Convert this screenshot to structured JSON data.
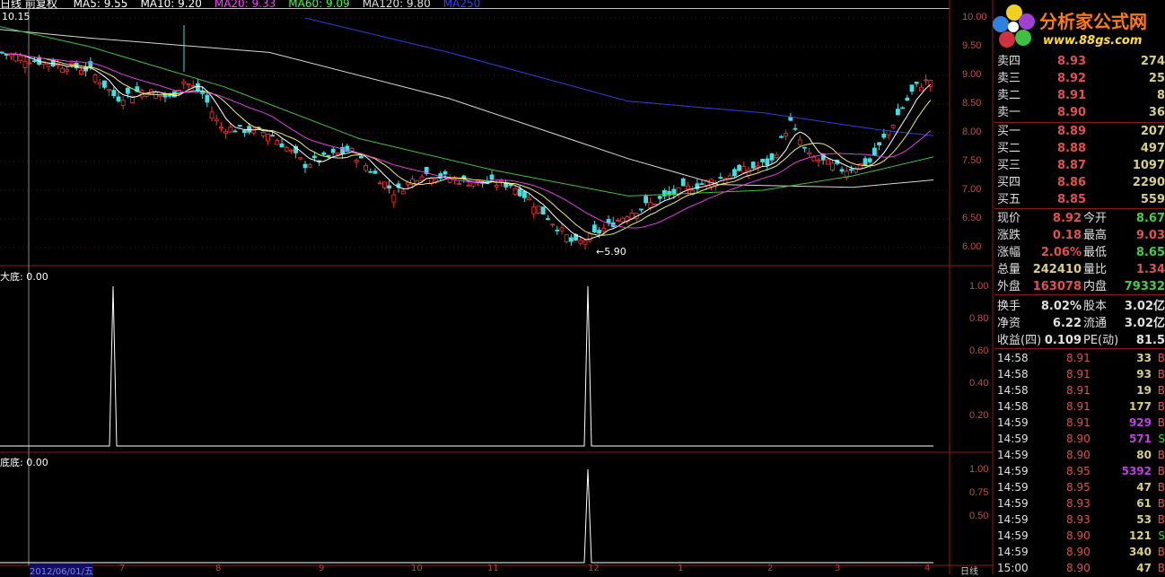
{
  "header": {
    "title": "日线 前复权",
    "ma": [
      {
        "label": "MA5: 9.55",
        "color": "#ffffff"
      },
      {
        "label": "MA10: 9.20",
        "color": "#ffffff"
      },
      {
        "label": "MA20: 9.33",
        "color": "#ff40ff"
      },
      {
        "label": "MA60: 9.09",
        "color": "#40ff40"
      },
      {
        "label": "MA120: 9.80",
        "color": "#e0e0e0"
      },
      {
        "label": "MA250",
        "color": "#3040ff"
      }
    ]
  },
  "main_chart": {
    "max_label": "10.15",
    "min_label": "5.90",
    "price_axis": [
      "10.00",
      "9.50",
      "9.00",
      "8.50",
      "8.00",
      "7.50",
      "7.00",
      "6.50",
      "6.00"
    ],
    "price_path": [
      [
        0,
        9.4
      ],
      [
        40,
        9.25
      ],
      [
        100,
        9.1
      ],
      [
        130,
        8.6
      ],
      [
        160,
        8.75
      ],
      [
        190,
        8.6
      ],
      [
        205,
        8.9
      ],
      [
        225,
        8.7
      ],
      [
        245,
        8.1
      ],
      [
        300,
        8.0
      ],
      [
        340,
        7.45
      ],
      [
        390,
        7.7
      ],
      [
        440,
        6.95
      ],
      [
        470,
        7.3
      ],
      [
        520,
        7.15
      ],
      [
        570,
        7.1
      ],
      [
        600,
        6.7
      ],
      [
        640,
        6.05
      ],
      [
        660,
        6.2
      ],
      [
        700,
        6.6
      ],
      [
        760,
        7.0
      ],
      [
        820,
        7.3
      ],
      [
        860,
        7.5
      ],
      [
        880,
        8.2
      ],
      [
        900,
        7.6
      ],
      [
        940,
        7.35
      ],
      [
        970,
        7.5
      ],
      [
        1000,
        8.3
      ],
      [
        1020,
        8.8
      ],
      [
        1040,
        8.95
      ]
    ],
    "ma_lines": {
      "ma120": {
        "color": "#d8d8d8",
        "pts": [
          [
            0,
            9.8
          ],
          [
            100,
            9.65
          ],
          [
            300,
            9.4
          ],
          [
            500,
            8.6
          ],
          [
            700,
            7.55
          ],
          [
            800,
            7.1
          ],
          [
            950,
            7.05
          ],
          [
            1040,
            7.18
          ]
        ]
      },
      "ma250": {
        "color": "#3040e0",
        "pts": [
          [
            340,
            10.0
          ],
          [
            500,
            9.4
          ],
          [
            700,
            8.55
          ],
          [
            850,
            8.35
          ],
          [
            980,
            8.05
          ],
          [
            1040,
            7.95
          ]
        ]
      },
      "ma60": {
        "color": "#40c040",
        "pts": [
          [
            0,
            9.85
          ],
          [
            100,
            9.5
          ],
          [
            250,
            8.8
          ],
          [
            400,
            7.9
          ],
          [
            550,
            7.35
          ],
          [
            700,
            6.9
          ],
          [
            850,
            7.0
          ],
          [
            950,
            7.25
          ],
          [
            1040,
            7.58
          ]
        ]
      }
    }
  },
  "indicator1": {
    "label": "大底: 0.00",
    "axis": [
      "1.00",
      "0.80",
      "0.60",
      "0.40",
      "0.20"
    ],
    "spikes": [
      126,
      655
    ]
  },
  "indicator2": {
    "label": "底底: 0.00",
    "axis": [
      "1.00",
      "0.75",
      "0.50"
    ],
    "spikes": [
      655
    ]
  },
  "x_axis": {
    "start": "2012/06/01/五",
    "months": [
      [
        "7",
        133
      ],
      [
        "8",
        240
      ],
      [
        "9",
        355
      ],
      [
        "10",
        458
      ],
      [
        "11",
        543
      ],
      [
        "12",
        655
      ],
      [
        "1",
        755
      ],
      [
        "2",
        855
      ],
      [
        "3",
        930
      ],
      [
        "4",
        1030
      ]
    ],
    "period": "日线"
  },
  "logo": {
    "name": "分析家公式网",
    "url": "www.88gs.com"
  },
  "orderbook": [
    {
      "label": "卖四",
      "price": "8.93",
      "vol": "274"
    },
    {
      "label": "卖三",
      "price": "8.92",
      "vol": "25"
    },
    {
      "label": "卖二",
      "price": "8.91",
      "vol": "8"
    },
    {
      "label": "卖一",
      "price": "8.90",
      "vol": "36"
    },
    {
      "label": "买一",
      "price": "8.89",
      "vol": "207"
    },
    {
      "label": "买二",
      "price": "8.88",
      "vol": "497"
    },
    {
      "label": "买三",
      "price": "8.87",
      "vol": "1097"
    },
    {
      "label": "买四",
      "price": "8.86",
      "vol": "2290"
    },
    {
      "label": "买五",
      "price": "8.85",
      "vol": "559"
    }
  ],
  "quote": [
    {
      "l1": "现价",
      "v1": "8.92",
      "c1": "red",
      "l2": "今开",
      "v2": "8.67",
      "c2": "grn"
    },
    {
      "l1": "涨跌",
      "v1": "0.18",
      "c1": "red",
      "l2": "最高",
      "v2": "9.03",
      "c2": "red"
    },
    {
      "l1": "涨幅",
      "v1": "2.06%",
      "c1": "red",
      "l2": "最低",
      "v2": "8.65",
      "c2": "grn"
    },
    {
      "l1": "总量",
      "v1": "242410",
      "c1": "yel",
      "l2": "量比",
      "v2": "1.34",
      "c2": "red"
    },
    {
      "l1": "外盘",
      "v1": "163078",
      "c1": "red",
      "l2": "内盘",
      "v2": "79332",
      "c2": "grn"
    },
    {
      "l1": "换手",
      "v1": "8.02%",
      "c1": "wht",
      "l2": "股本",
      "v2": "3.02亿",
      "c2": "wht"
    },
    {
      "l1": "净资",
      "v1": "6.22",
      "c1": "wht",
      "l2": "流通",
      "v2": "3.02亿",
      "c2": "wht"
    },
    {
      "l1": "收益(四)",
      "v1": "0.109",
      "c1": "wht",
      "l2": "PE(动)",
      "v2": "81.5",
      "c2": "wht"
    }
  ],
  "trades": [
    {
      "time": "14:58",
      "price": "8.91",
      "vol": "33",
      "side": "B",
      "vc": "yel"
    },
    {
      "time": "14:58",
      "price": "8.91",
      "vol": "93",
      "side": "B",
      "vc": "yel"
    },
    {
      "time": "14:58",
      "price": "8.91",
      "vol": "19",
      "side": "B",
      "vc": "yel"
    },
    {
      "time": "14:58",
      "price": "8.91",
      "vol": "177",
      "side": "B",
      "vc": "yel"
    },
    {
      "time": "14:59",
      "price": "8.91",
      "vol": "929",
      "side": "B",
      "vc": "mag"
    },
    {
      "time": "14:59",
      "price": "8.90",
      "vol": "571",
      "side": "S",
      "vc": "mag"
    },
    {
      "time": "14:59",
      "price": "8.90",
      "vol": "80",
      "side": "B",
      "vc": "yel"
    },
    {
      "time": "14:59",
      "price": "8.95",
      "vol": "5392",
      "side": "B",
      "vc": "mag"
    },
    {
      "time": "14:59",
      "price": "8.95",
      "vol": "47",
      "side": "B",
      "vc": "yel"
    },
    {
      "time": "14:59",
      "price": "8.93",
      "vol": "61",
      "side": "B",
      "vc": "yel"
    },
    {
      "time": "14:59",
      "price": "8.93",
      "vol": "53",
      "side": "B",
      "vc": "yel"
    },
    {
      "time": "14:59",
      "price": "8.90",
      "vol": "121",
      "side": "S",
      "vc": "yel"
    },
    {
      "time": "14:59",
      "price": "8.90",
      "vol": "340",
      "side": "B",
      "vc": "yel"
    },
    {
      "time": "15:00",
      "price": "8.90",
      "vol": "47",
      "side": "B",
      "vc": "yel"
    }
  ]
}
